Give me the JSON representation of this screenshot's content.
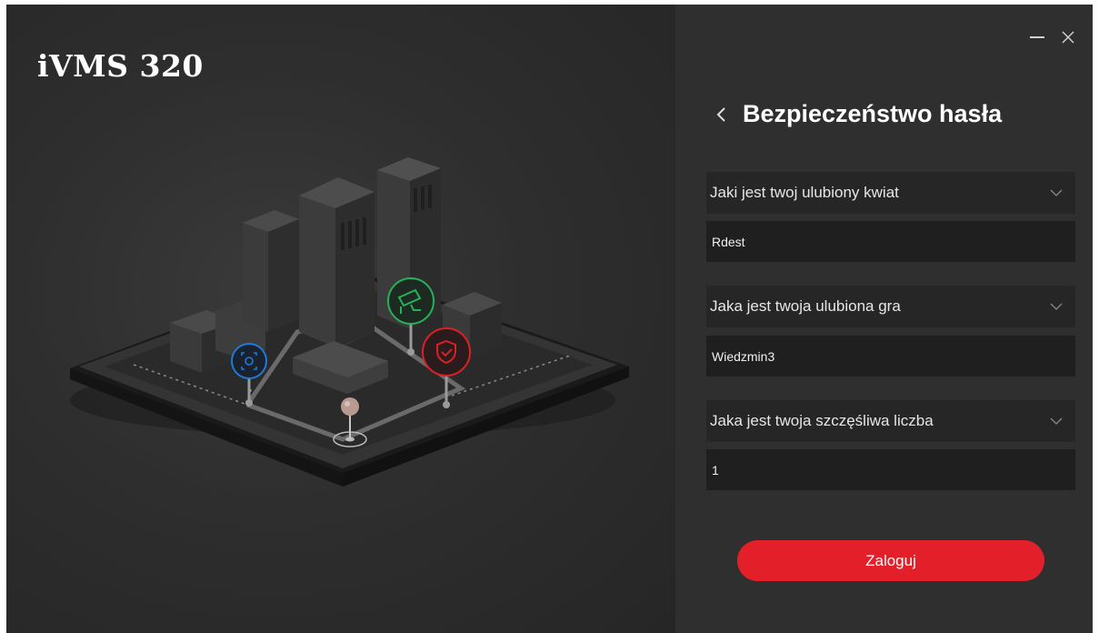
{
  "app": {
    "title": "iVMS 320"
  },
  "panel": {
    "heading": "Bezpieczeństwo hasła",
    "questions": [
      {
        "question": "Jaki jest twoj ulubiony kwiat",
        "answer": "Rdest"
      },
      {
        "question": "Jaka jest twoja ulubiona gra",
        "answer": "Wiedzmin3"
      },
      {
        "question": "Jaka jest twoja szczęśliwa liczba",
        "answer": "1"
      }
    ],
    "login_label": "Zaloguj"
  },
  "colors": {
    "accent": "#e3202a",
    "panel_bg": "#2f2f2f",
    "hero_bg": "#2b2b2b",
    "camera_icon": "#27b15a",
    "face_icon": "#1e7bd6",
    "shield_icon": "#d92127"
  },
  "icons": [
    "minimize-icon",
    "close-icon",
    "back-chevron-icon",
    "chevron-down-icon",
    "camera-icon",
    "face-scan-icon",
    "shield-check-icon",
    "location-pin-icon"
  ]
}
